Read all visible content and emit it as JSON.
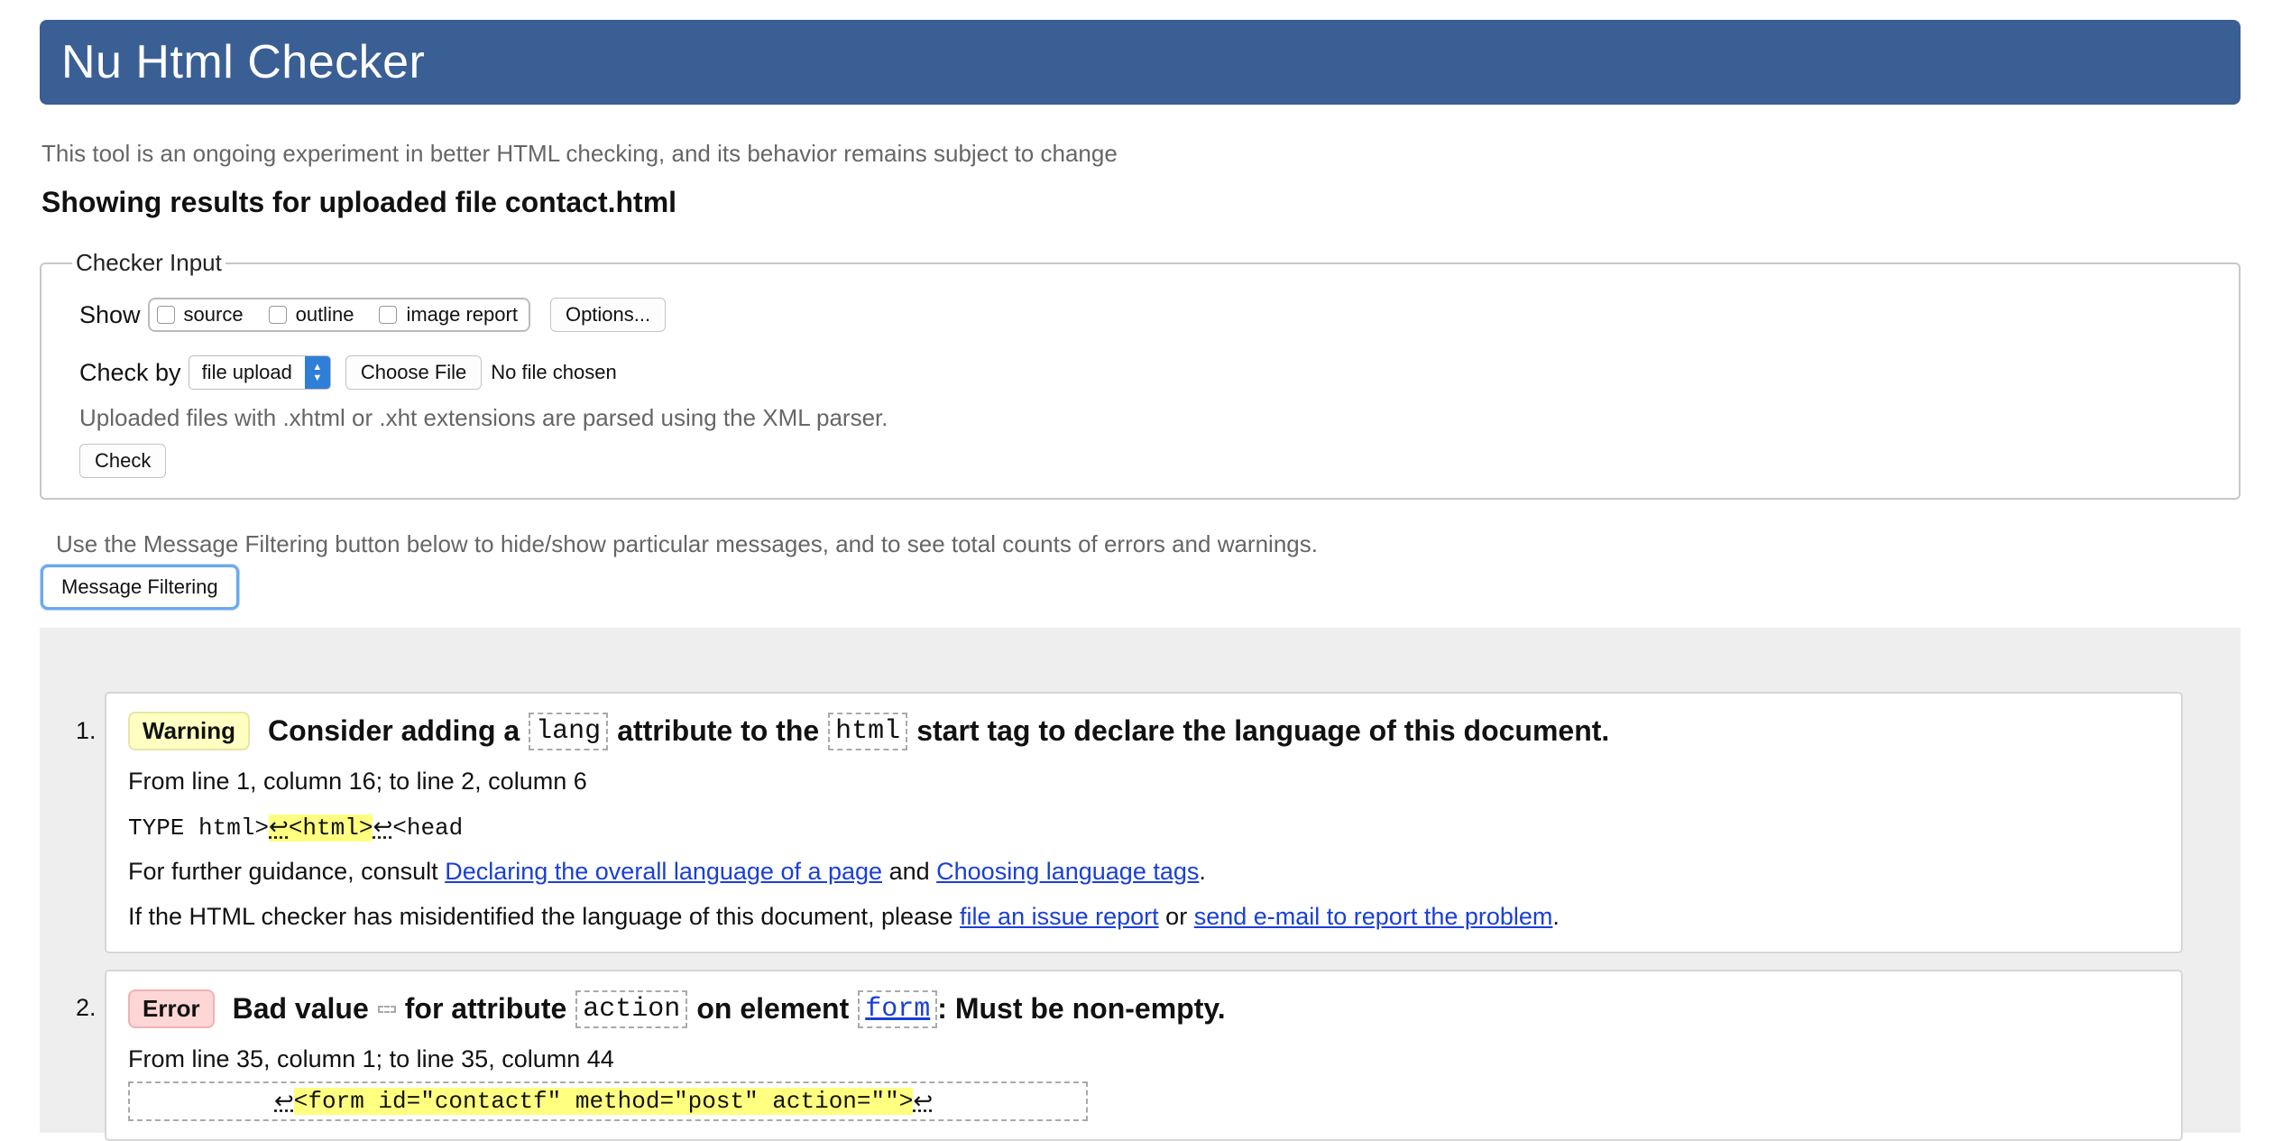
{
  "header": {
    "title": "Nu Html Checker"
  },
  "intro": "This tool is an ongoing experiment in better HTML checking, and its behavior remains subject to change",
  "showing": "Showing results for uploaded file contact.html",
  "checker": {
    "legend": "Checker Input",
    "show_label": "Show",
    "options": [
      "source",
      "outline",
      "image report"
    ],
    "options_button": "Options...",
    "check_by_label": "Check by",
    "check_by_value": "file upload",
    "choose_file": "Choose File",
    "no_file": "No file chosen",
    "hint": "Uploaded files with .xhtml or .xht extensions are parsed using the XML parser.",
    "check_button": "Check"
  },
  "filter": {
    "note": "Use the Message Filtering button below to hide/show particular messages, and to see total counts of errors and warnings.",
    "button": "Message Filtering"
  },
  "messages": [
    {
      "num": "1.",
      "type": "Warning",
      "title": {
        "p1": "Consider adding a",
        "c1": "lang",
        "p2": "attribute to the",
        "c2": "html",
        "p3": "start tag to declare the language of this document."
      },
      "location": "From line 1, column 16; to line 2, column 6",
      "extract": {
        "pre": "TYPE html>",
        "lf1": "↩",
        "hl": "<html>",
        "lf2": "↩",
        "post": "<head"
      },
      "guidance": {
        "prefix": "For further guidance, consult",
        "link1": "Declaring the overall language of a page",
        "mid": "and",
        "link2": "Choosing language tags",
        "suffix": "."
      },
      "misid": {
        "prefix": "If the HTML checker has misidentified the language of this document, please",
        "link1": "file an issue report",
        "mid": "or",
        "link2": "send e-mail to report the problem",
        "suffix": "."
      }
    },
    {
      "num": "2.",
      "type": "Error",
      "title": {
        "p1": "Bad value",
        "c1": "",
        "p2": "for attribute",
        "c2": "action",
        "p3": "on element",
        "c3": "form",
        "p4": ": Must be non-empty."
      },
      "location": "From line 35, column 1; to line 35, column 44",
      "extract": {
        "lf1": "↩",
        "hl": "<form id=\"contactf\" method=\"post\" action=\"\">",
        "lf2": "↩"
      }
    }
  ]
}
